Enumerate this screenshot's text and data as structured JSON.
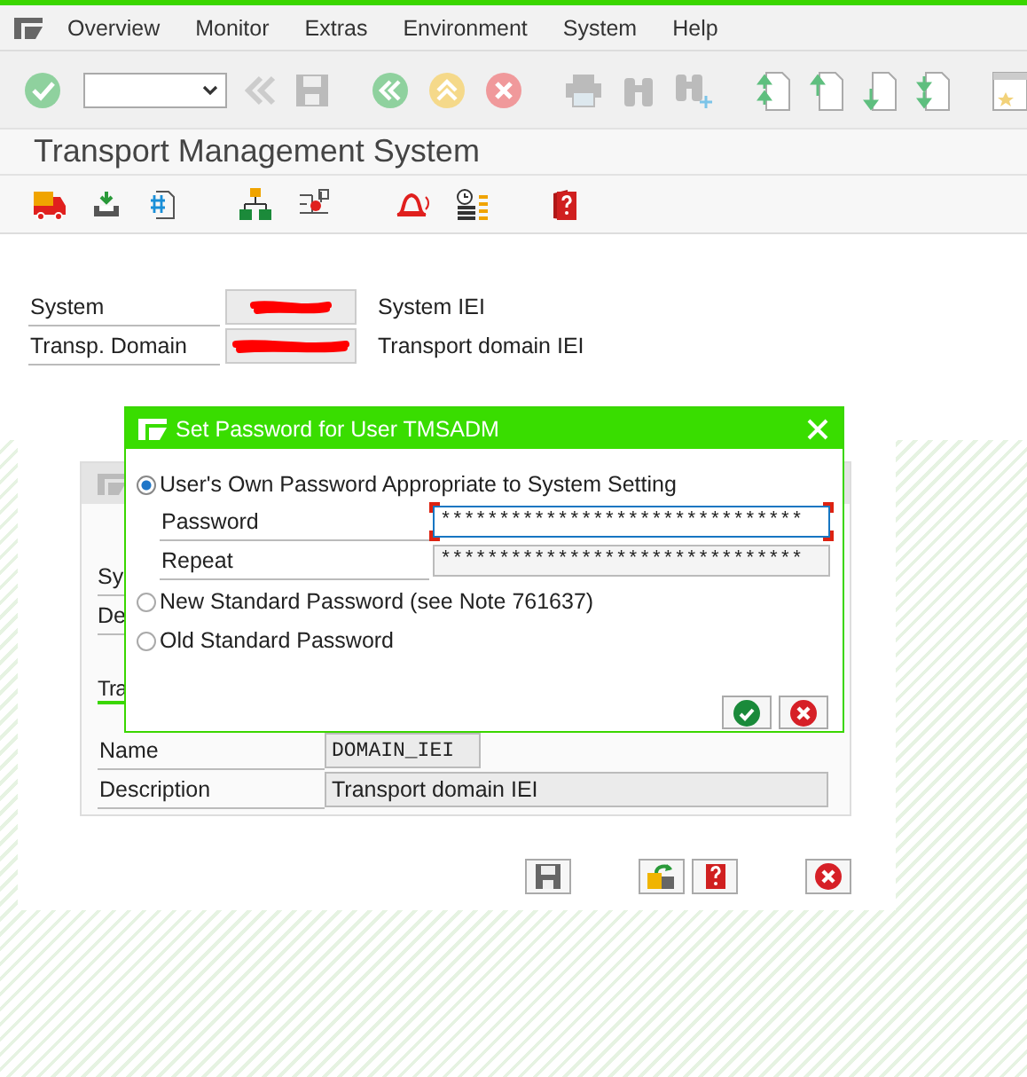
{
  "menu_bar": {
    "items": [
      "Overview",
      "Monitor",
      "Extras",
      "Environment",
      "System",
      "Help"
    ]
  },
  "title": "Transport Management System",
  "header_fields": [
    {
      "label": "System",
      "description": "System IEI"
    },
    {
      "label": "Transp. Domain",
      "description": "Transport domain IEI"
    }
  ],
  "background_dialog": {
    "fields": [
      {
        "label": "Sy"
      },
      {
        "label": "De"
      }
    ],
    "tab": "Tra",
    "rows": [
      {
        "label": "Name",
        "value": "DOMAIN_IEI"
      },
      {
        "label": "Description",
        "value": "Transport domain IEI"
      }
    ]
  },
  "popup": {
    "title": "Set Password for User TMSADM",
    "options": [
      {
        "label": "User's Own Password Appropriate to System Setting",
        "selected": true
      },
      {
        "label": "New Standard Password (see Note 761637)",
        "selected": false
      },
      {
        "label": "Old Standard Password",
        "selected": false
      }
    ],
    "fields": [
      {
        "label": "Password",
        "value": "*******************************",
        "focused": true
      },
      {
        "label": "Repeat",
        "value": "*******************************",
        "focused": false
      }
    ]
  }
}
